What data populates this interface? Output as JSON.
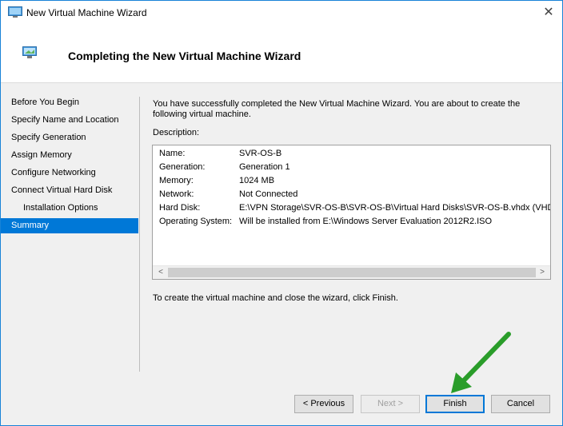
{
  "window": {
    "title": "New Virtual Machine Wizard",
    "close_glyph": "✕"
  },
  "header": {
    "title": "Completing the New Virtual Machine Wizard"
  },
  "nav": {
    "items": [
      {
        "label": "Before You Begin"
      },
      {
        "label": "Specify Name and Location"
      },
      {
        "label": "Specify Generation"
      },
      {
        "label": "Assign Memory"
      },
      {
        "label": "Configure Networking"
      },
      {
        "label": "Connect Virtual Hard Disk"
      },
      {
        "label": "Installation Options"
      },
      {
        "label": "Summary"
      }
    ],
    "selected": "Summary"
  },
  "main": {
    "intro": "You have successfully completed the New Virtual Machine Wizard. You are about to create the following virtual machine.",
    "description_label": "Description:",
    "summary": [
      {
        "key": "Name:",
        "value": "SVR-OS-B"
      },
      {
        "key": "Generation:",
        "value": "Generation 1"
      },
      {
        "key": "Memory:",
        "value": "1024 MB"
      },
      {
        "key": "Network:",
        "value": "Not Connected"
      },
      {
        "key": "Hard Disk:",
        "value": "E:\\VPN Storage\\SVR-OS-B\\SVR-OS-B\\Virtual Hard Disks\\SVR-OS-B.vhdx (VHDX, d"
      },
      {
        "key": "Operating System:",
        "value": "Will be installed from E:\\Windows Server Evaluation 2012R2.ISO"
      }
    ],
    "scroll_left_glyph": "<",
    "scroll_right_glyph": ">",
    "finish_note": "To create the virtual machine and close the wizard, click Finish."
  },
  "buttons": {
    "previous": "< Previous",
    "next": "Next >",
    "finish": "Finish",
    "cancel": "Cancel"
  },
  "colors": {
    "accent": "#0078d7",
    "annotation_arrow": "#2a9d2a"
  }
}
